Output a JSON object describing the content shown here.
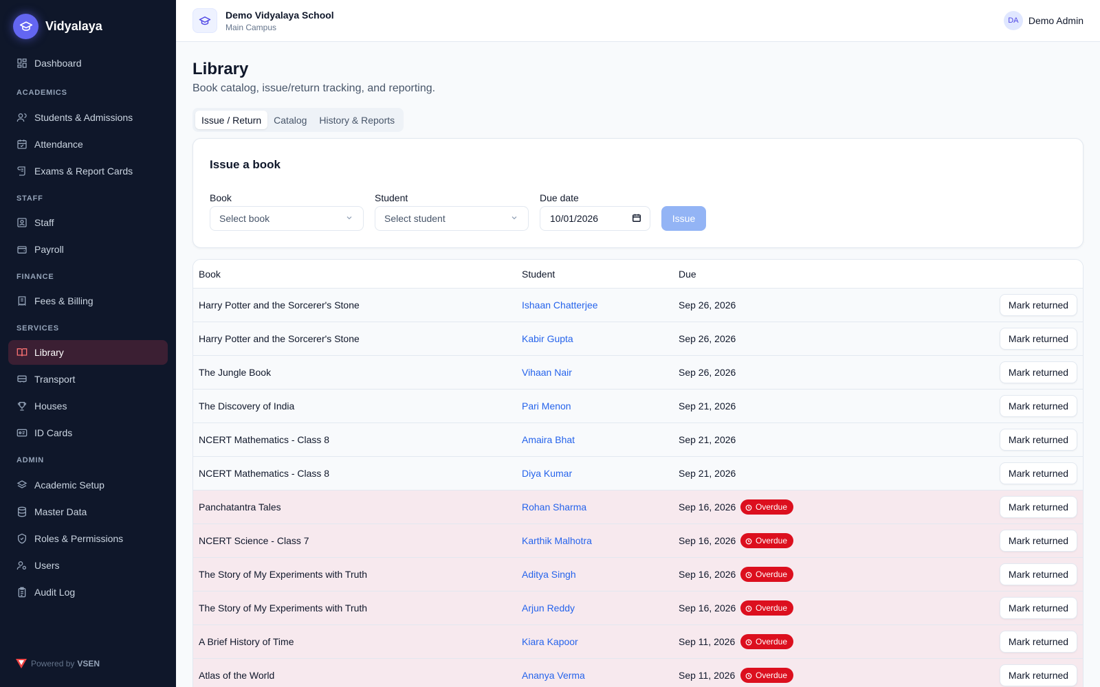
{
  "brand": {
    "name": "Vidyalaya"
  },
  "sidebar": {
    "sections": {
      "academics": "ACADEMICS",
      "staff": "STAFF",
      "finance": "FINANCE",
      "services": "SERVICES",
      "admin": "ADMIN"
    },
    "items": {
      "dashboard": "Dashboard",
      "students": "Students & Admissions",
      "attendance": "Attendance",
      "exams": "Exams & Report Cards",
      "staff": "Staff",
      "payroll": "Payroll",
      "fees": "Fees & Billing",
      "library": "Library",
      "transport": "Transport",
      "houses": "Houses",
      "id_cards": "ID Cards",
      "academic_setup": "Academic Setup",
      "master_data": "Master Data",
      "roles": "Roles & Permissions",
      "users": "Users",
      "audit_log": "Audit Log"
    },
    "active_item": "library",
    "footer": {
      "prefix": "Powered by",
      "brand": "VSEN"
    }
  },
  "header": {
    "school_name": "Demo Vidyalaya School",
    "campus": "Main Campus",
    "user": {
      "initials": "DA",
      "name": "Demo Admin"
    }
  },
  "page": {
    "title": "Library",
    "subtitle": "Book catalog, issue/return tracking, and reporting."
  },
  "tabs": {
    "issue_return": "Issue / Return",
    "catalog": "Catalog",
    "history": "History & Reports",
    "active": "issue_return"
  },
  "issue_form": {
    "title": "Issue a book",
    "book_label": "Book",
    "book_placeholder": "Select book",
    "student_label": "Student",
    "student_placeholder": "Select student",
    "due_label": "Due date",
    "due_value": "10/01/2026",
    "issue_button": "Issue"
  },
  "table": {
    "headers": {
      "book": "Book",
      "student": "Student",
      "due": "Due"
    },
    "overdue_label": "Overdue",
    "action_label": "Mark returned",
    "rows": [
      {
        "book": "Harry Potter and the Sorcerer's Stone",
        "student": "Ishaan Chatterjee",
        "due": "Sep 26, 2026",
        "overdue": false
      },
      {
        "book": "Harry Potter and the Sorcerer's Stone",
        "student": "Kabir Gupta",
        "due": "Sep 26, 2026",
        "overdue": false
      },
      {
        "book": "The Jungle Book",
        "student": "Vihaan Nair",
        "due": "Sep 26, 2026",
        "overdue": false
      },
      {
        "book": "The Discovery of India",
        "student": "Pari Menon",
        "due": "Sep 21, 2026",
        "overdue": false
      },
      {
        "book": "NCERT Mathematics - Class 8",
        "student": "Amaira Bhat",
        "due": "Sep 21, 2026",
        "overdue": false
      },
      {
        "book": "NCERT Mathematics - Class 8",
        "student": "Diya Kumar",
        "due": "Sep 21, 2026",
        "overdue": false
      },
      {
        "book": "Panchatantra Tales",
        "student": "Rohan Sharma",
        "due": "Sep 16, 2026",
        "overdue": true
      },
      {
        "book": "NCERT Science - Class 7",
        "student": "Karthik Malhotra",
        "due": "Sep 16, 2026",
        "overdue": true
      },
      {
        "book": "The Story of My Experiments with Truth",
        "student": "Aditya Singh",
        "due": "Sep 16, 2026",
        "overdue": true
      },
      {
        "book": "The Story of My Experiments with Truth",
        "student": "Arjun Reddy",
        "due": "Sep 16, 2026",
        "overdue": true
      },
      {
        "book": "A Brief History of Time",
        "student": "Kiara Kapoor",
        "due": "Sep 11, 2026",
        "overdue": true
      },
      {
        "book": "Atlas of the World",
        "student": "Ananya Verma",
        "due": "Sep 11, 2026",
        "overdue": true
      }
    ]
  },
  "colors": {
    "sidebar_bg": "#0f172a",
    "accent": "#6366f1",
    "active_nav_bg": "#3b1f33",
    "active_nav_icon": "#f87171",
    "link": "#2563eb",
    "overdue_badge": "#dc0f1e",
    "overdue_row": "#f7e9ee"
  }
}
